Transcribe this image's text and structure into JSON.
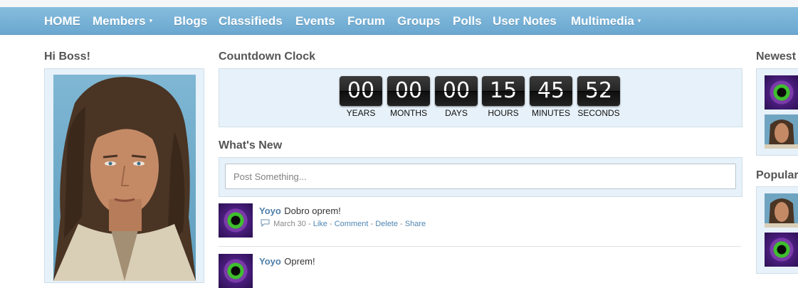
{
  "nav": {
    "items": [
      {
        "label": "HOME",
        "has_caret": false
      },
      {
        "label": "Members",
        "has_caret": true
      },
      {
        "label": "Blogs",
        "has_caret": false
      },
      {
        "label": "Classifieds",
        "has_caret": false
      },
      {
        "label": "Events",
        "has_caret": false
      },
      {
        "label": "Forum",
        "has_caret": false
      },
      {
        "label": "Groups",
        "has_caret": false
      },
      {
        "label": "Polls",
        "has_caret": false
      },
      {
        "label": "User Notes",
        "has_caret": false
      },
      {
        "label": "Multimedia",
        "has_caret": true
      }
    ],
    "caret_glyph": "▾"
  },
  "profile": {
    "greeting": "Hi Boss!"
  },
  "countdown": {
    "title": "Countdown Clock",
    "units": [
      {
        "value": "00",
        "label": "YEARS"
      },
      {
        "value": "00",
        "label": "MONTHS"
      },
      {
        "value": "00",
        "label": "DAYS"
      },
      {
        "value": "15",
        "label": "HOURS"
      },
      {
        "value": "45",
        "label": "MINUTES"
      },
      {
        "value": "52",
        "label": "SECONDS"
      }
    ]
  },
  "whats_new": {
    "title": "What's New",
    "post_placeholder": "Post Something...",
    "feed": [
      {
        "user": "Yoyo",
        "text": "Dobro oprem!",
        "date": "March 30",
        "actions": [
          "Like",
          "Comment",
          "Delete",
          "Share"
        ]
      },
      {
        "user": "Yoyo",
        "text": "Oprem!"
      }
    ]
  },
  "right_column": {
    "newest_title": "Newest",
    "popular_title": "Popular"
  },
  "colors": {
    "nav_bg": "#78b2d7",
    "panel_bg": "#e7f1f9",
    "link": "#4f86b3",
    "user_name": "#4f7fa8"
  },
  "icons": {
    "comment_icon": "speech-bubble",
    "dropdown_icon": "caret-down"
  }
}
